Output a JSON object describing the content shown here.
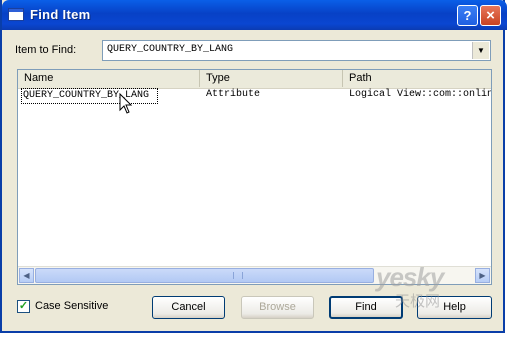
{
  "window": {
    "title": "Find Item"
  },
  "title_buttons": {
    "help": "?",
    "close": "×"
  },
  "item_to_find": {
    "label": "Item to Find:",
    "value": "QUERY_COUNTRY_BY_LANG"
  },
  "list": {
    "columns": [
      "Name",
      "Type",
      "Path"
    ],
    "rows": [
      {
        "name": "QUERY_COUNTRY_BY_LANG",
        "type": "Attribute",
        "path": "Logical View::com::onlin"
      }
    ]
  },
  "scroll": {
    "left": "◀",
    "right": "▶"
  },
  "case_sensitive": {
    "label": "Case Sensitive",
    "checked": true
  },
  "buttons": {
    "cancel": "Cancel",
    "browse": "Browse",
    "find": "Find",
    "help": "Help"
  },
  "watermark": {
    "text": "yesky",
    "subtext": "天极网"
  }
}
